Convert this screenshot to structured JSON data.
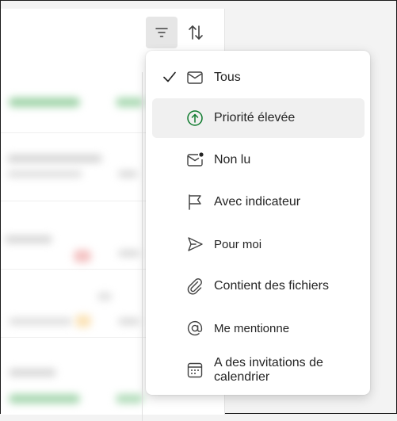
{
  "toolbar": {
    "filter_icon": "filter-icon",
    "sort_icon": "sort-icon"
  },
  "colors": {
    "accent_green": "#0f7b2e",
    "text": "#242424",
    "hover_bg": "#f0f0f0"
  },
  "filter_menu": {
    "items": [
      {
        "label": "Tous",
        "icon": "mail-icon",
        "checked": true
      },
      {
        "label": "Priorité élevée",
        "icon": "arrow-up-circle-icon",
        "checked": false,
        "hovered": true
      },
      {
        "label": "Non lu",
        "icon": "mail-unread-icon",
        "checked": false
      },
      {
        "label": "Avec indicateur",
        "icon": "flag-icon",
        "checked": false
      },
      {
        "label": "Pour moi",
        "icon": "send-icon",
        "checked": false
      },
      {
        "label": "Contient des fichiers",
        "icon": "attachment-icon",
        "checked": false
      },
      {
        "label": "Me mentionne",
        "icon": "mention-icon",
        "checked": false
      },
      {
        "label": "A des invitations de calendrier",
        "icon": "calendar-icon",
        "checked": false
      }
    ]
  }
}
